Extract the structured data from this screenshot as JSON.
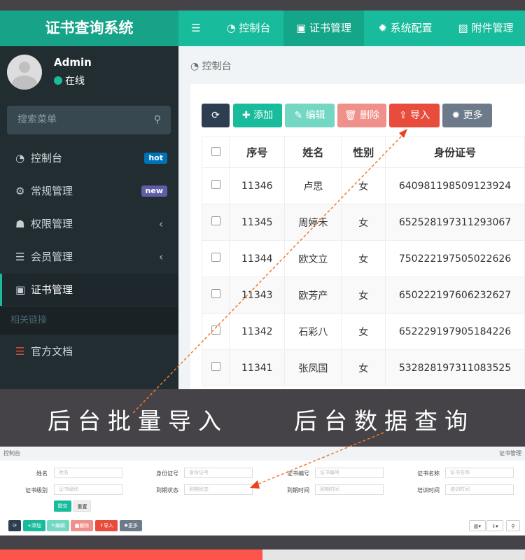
{
  "app": {
    "title": "证书查询系统"
  },
  "nav": [
    {
      "label": "控制台",
      "icon": "dashboard-icon"
    },
    {
      "label": "证书管理",
      "icon": "id-card-icon"
    },
    {
      "label": "系统配置",
      "icon": "gear-icon"
    },
    {
      "label": "附件管理",
      "icon": "image-icon"
    }
  ],
  "user": {
    "name": "Admin",
    "status": "在线"
  },
  "sidebar": {
    "search_placeholder": "搜索菜单",
    "items": [
      {
        "label": "控制台",
        "badge": "hot",
        "badge_color": "#0073b7"
      },
      {
        "label": "常规管理",
        "badge": "new",
        "badge_color": "#605ca8"
      },
      {
        "label": "权限管理"
      },
      {
        "label": "会员管理"
      },
      {
        "label": "证书管理"
      }
    ],
    "section": "相关链接",
    "links": [
      {
        "label": "官方文档"
      }
    ]
  },
  "breadcrumb": "控制台",
  "toolbar": {
    "add": "添加",
    "edit": "编辑",
    "delete": "删除",
    "import": "导入",
    "more": "更多"
  },
  "table": {
    "headers": [
      "序号",
      "姓名",
      "性别",
      "身份证号"
    ],
    "rows": [
      [
        "11346",
        "卢思",
        "女",
        "640981198509123924"
      ],
      [
        "11345",
        "周婷禾",
        "女",
        "652528197311293067"
      ],
      [
        "11344",
        "欧文立",
        "女",
        "750222197505022626"
      ],
      [
        "11343",
        "欧芳产",
        "女",
        "650222197606232627"
      ],
      [
        "11342",
        "石彩八",
        "女",
        "652229197905184226"
      ],
      [
        "11341",
        "张凤国",
        "女",
        "532828197311083525"
      ]
    ]
  },
  "captions": {
    "import": "后台批量导入",
    "query": "后台数据查询"
  },
  "shot2": {
    "breadcrumb": "控制台",
    "right_crumb": "证书管理",
    "fields": [
      {
        "label": "姓名",
        "placeholder": "姓名"
      },
      {
        "label": "身份证号",
        "placeholder": "身份证号"
      },
      {
        "label": "证书编号",
        "placeholder": "证书编号"
      },
      {
        "label": "证书名称",
        "placeholder": "证书名称"
      },
      {
        "label": "证书级别",
        "placeholder": "证书级别"
      },
      {
        "label": "到期状态",
        "placeholder": "到期状态"
      },
      {
        "label": "到期时间",
        "placeholder": "到期时间"
      },
      {
        "label": "培训时间",
        "placeholder": "培训时间"
      }
    ],
    "submit": "提交",
    "reset": "重置"
  }
}
